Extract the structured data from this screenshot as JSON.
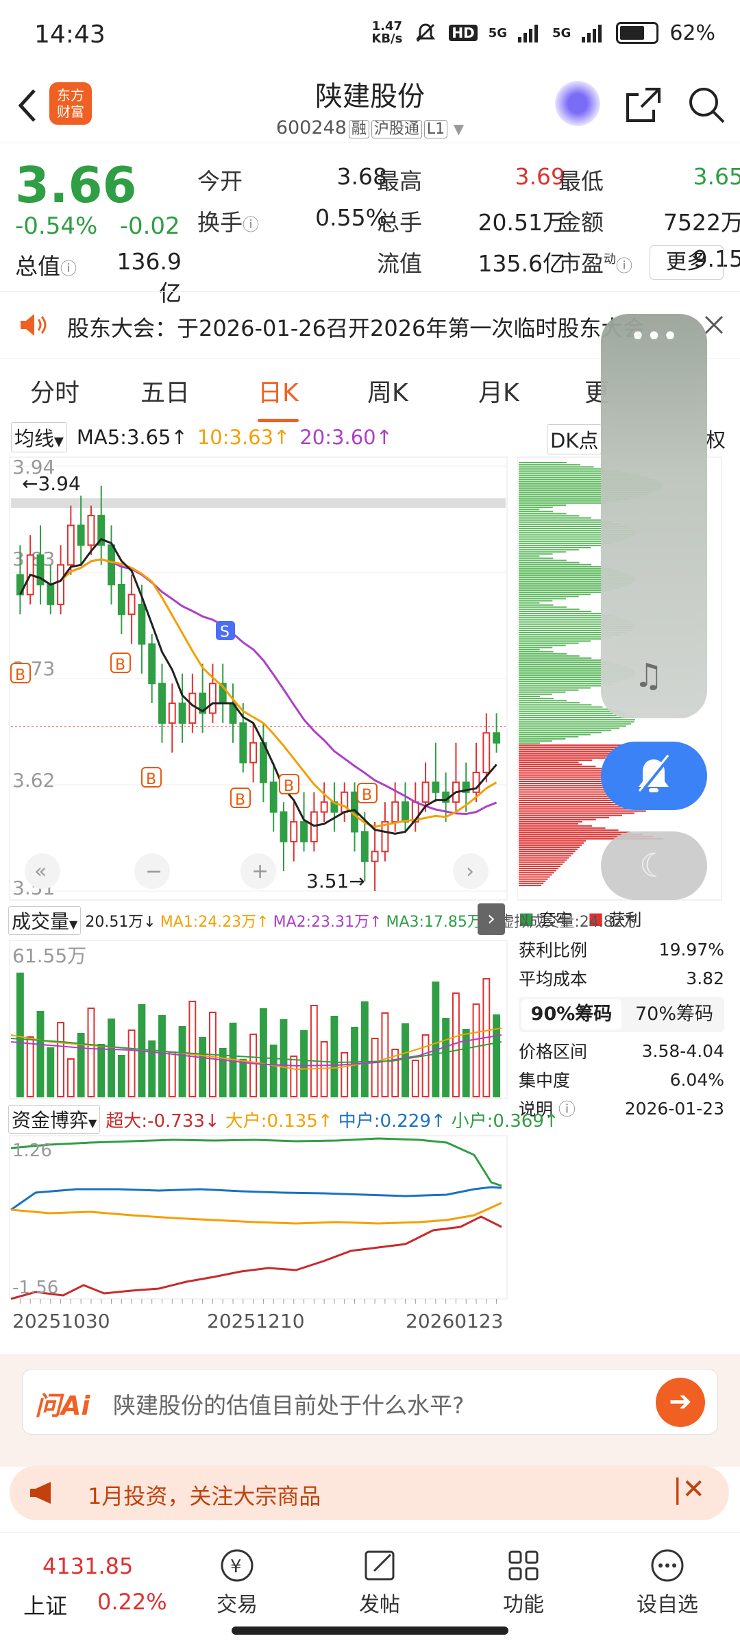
{
  "status_bar": {
    "time": "14:43",
    "net_speed_value": "1.47",
    "net_speed_unit": "KB/s",
    "hd": "HD",
    "sig1": "5G",
    "sig2": "5G",
    "battery": "62%"
  },
  "header": {
    "logo_line1": "东方",
    "logo_line2": "财富",
    "title": "陕建股份",
    "code": "600248",
    "tags": [
      "融",
      "沪股通",
      "L1"
    ]
  },
  "quote": {
    "price": "3.66",
    "change_pct": "-0.54%",
    "change_abs": "-0.02",
    "stats": [
      {
        "label": "今开",
        "value": "3.68",
        "color": "#222"
      },
      {
        "label": "最高",
        "value": "3.69",
        "color": "#e03131"
      },
      {
        "label": "最低",
        "value": "3.65",
        "color": "#2f9e44"
      },
      {
        "label": "换手",
        "value": "0.55%",
        "color": "#222"
      },
      {
        "label": "总手",
        "value": "20.51万",
        "color": "#222"
      },
      {
        "label": "金额",
        "value": "7522万",
        "color": "#222"
      },
      {
        "label": "总值",
        "value": "136.9亿",
        "color": "#222"
      },
      {
        "label": "流值",
        "value": "135.6亿",
        "color": "#222"
      },
      {
        "label": "市盈",
        "value": "9.15",
        "color": "#222"
      }
    ],
    "pe_superscript": "动",
    "more": "更多"
  },
  "notice": {
    "text": "股东大会：于2026-01-26召开2026年第一次临时股东大会"
  },
  "period_tabs": [
    "分时",
    "五日",
    "日K",
    "周K",
    "月K",
    "更"
  ],
  "active_tab": "日K",
  "ma_row": {
    "selector": "均线",
    "ma5": "MA5:3.65↑",
    "ma10": "10:3.63↑",
    "ma20": "20:3.60↑",
    "dk": "DK点",
    "fq": "权"
  },
  "kline": {
    "ylabels": [
      "3.94",
      "3.83",
      "3.73",
      "3.62",
      "3.51"
    ],
    "max_label": "←3.94",
    "min_label": "3.51→",
    "b_markers": [
      "B",
      "B",
      "B",
      "B",
      "B",
      "B"
    ],
    "s_marker": "S",
    "controls": [
      "«",
      "−",
      "+",
      "‹",
      "›"
    ]
  },
  "chart_data": {
    "type": "candlestick",
    "x_ticks": [
      "20251030",
      "20251210",
      "20260123"
    ],
    "ylim": [
      3.51,
      3.94
    ],
    "candles": [
      [
        3.83,
        3.81,
        3.86,
        3.79
      ],
      [
        3.81,
        3.85,
        3.87,
        3.8
      ],
      [
        3.85,
        3.82,
        3.88,
        3.8
      ],
      [
        3.82,
        3.8,
        3.84,
        3.79
      ],
      [
        3.8,
        3.84,
        3.86,
        3.79
      ],
      [
        3.84,
        3.88,
        3.9,
        3.83
      ],
      [
        3.88,
        3.86,
        3.91,
        3.84
      ],
      [
        3.86,
        3.89,
        3.9,
        3.85
      ],
      [
        3.89,
        3.86,
        3.92,
        3.84
      ],
      [
        3.86,
        3.82,
        3.88,
        3.8
      ],
      [
        3.82,
        3.79,
        3.84,
        3.77
      ],
      [
        3.79,
        3.81,
        3.83,
        3.76
      ],
      [
        3.8,
        3.76,
        3.82,
        3.73
      ],
      [
        3.76,
        3.72,
        3.77,
        3.7
      ],
      [
        3.72,
        3.68,
        3.74,
        3.66
      ],
      [
        3.68,
        3.7,
        3.72,
        3.65
      ],
      [
        3.7,
        3.68,
        3.73,
        3.66
      ],
      [
        3.68,
        3.71,
        3.73,
        3.67
      ],
      [
        3.71,
        3.69,
        3.74,
        3.67
      ],
      [
        3.69,
        3.72,
        3.74,
        3.68
      ],
      [
        3.72,
        3.7,
        3.74,
        3.68
      ],
      [
        3.7,
        3.68,
        3.72,
        3.66
      ],
      [
        3.68,
        3.64,
        3.7,
        3.63
      ],
      [
        3.64,
        3.66,
        3.68,
        3.62
      ],
      [
        3.66,
        3.62,
        3.68,
        3.6
      ],
      [
        3.62,
        3.59,
        3.64,
        3.57
      ],
      [
        3.59,
        3.56,
        3.6,
        3.53
      ],
      [
        3.56,
        3.58,
        3.6,
        3.54
      ],
      [
        3.58,
        3.56,
        3.61,
        3.55
      ],
      [
        3.56,
        3.59,
        3.61,
        3.55
      ],
      [
        3.59,
        3.6,
        3.62,
        3.58
      ],
      [
        3.6,
        3.59,
        3.62,
        3.57
      ],
      [
        3.59,
        3.61,
        3.62,
        3.58
      ],
      [
        3.61,
        3.57,
        3.62,
        3.55
      ],
      [
        3.57,
        3.54,
        3.59,
        3.52
      ],
      [
        3.54,
        3.55,
        3.58,
        3.51
      ],
      [
        3.55,
        3.58,
        3.6,
        3.54
      ],
      [
        3.58,
        3.6,
        3.62,
        3.57
      ],
      [
        3.6,
        3.58,
        3.62,
        3.57
      ],
      [
        3.58,
        3.6,
        3.62,
        3.57
      ],
      [
        3.6,
        3.62,
        3.64,
        3.59
      ],
      [
        3.62,
        3.61,
        3.66,
        3.6
      ],
      [
        3.61,
        3.6,
        3.63,
        3.58
      ],
      [
        3.6,
        3.62,
        3.66,
        3.59
      ],
      [
        3.62,
        3.61,
        3.64,
        3.59
      ],
      [
        3.61,
        3.63,
        3.66,
        3.6
      ],
      [
        3.63,
        3.67,
        3.69,
        3.62
      ],
      [
        3.67,
        3.66,
        3.69,
        3.65
      ]
    ]
  },
  "chips": {
    "legend_hold": "套牢",
    "legend_profit": "获利",
    "profit_ratio_label": "获利比例",
    "profit_ratio": "19.97%",
    "avg_cost_label": "平均成本",
    "avg_cost": "3.82",
    "tab90": "90%筹码",
    "tab70": "70%筹码",
    "range_label": "价格区间",
    "range": "3.58-4.04",
    "conc_label": "集中度",
    "conc": "6.04%",
    "note_label": "说明",
    "note_date": "2026-01-23"
  },
  "volume": {
    "selector": "成交量",
    "vol": "20.51万↓",
    "ma1": "MA1:24.23万↑",
    "ma2": "MA2:23.31万↑",
    "ma3": "MA3:17.85万↑",
    "virtual": "虚拟成交量:24.82万",
    "ymax": "61.55万"
  },
  "funds": {
    "selector": "资金博弈",
    "super": "超大:-0.733↓",
    "big": "大户:0.135↑",
    "mid": "中户:0.229↑",
    "small": "小户:0.369↑",
    "ymax": "1.26",
    "ymin": "-1.56"
  },
  "ai": {
    "logo": "问Ai",
    "placeholder": "陕建股份的估值目前处于什么水平?"
  },
  "promo": {
    "text": "1月投资，关注大宗商品"
  },
  "bottom_bar": {
    "index_value": "4131.85",
    "index_name": "上证",
    "index_change": "0.22%",
    "items": [
      "交易",
      "发帖",
      "功能",
      "设自选"
    ]
  },
  "colors": {
    "up": "#e03131",
    "down": "#2f9e44",
    "accent": "#f06022",
    "ma5": "#222222",
    "ma10": "#f59f00",
    "ma20": "#ae3ec9"
  }
}
